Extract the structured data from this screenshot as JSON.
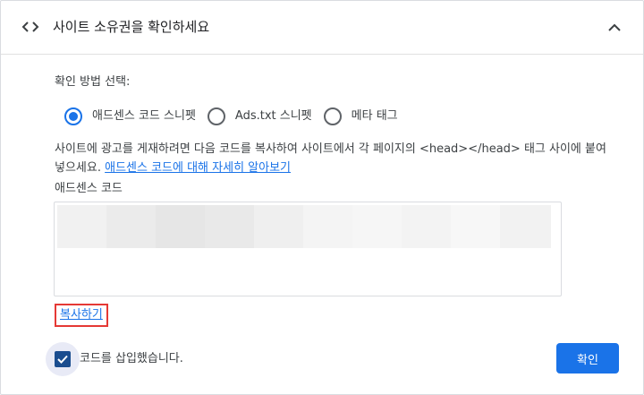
{
  "header": {
    "title": "사이트 소유권을 확인하세요",
    "left_icon": "code-icon",
    "right_icon": "chevron-up-icon"
  },
  "method": {
    "label": "확인 방법 선택:",
    "options": [
      {
        "label": "애드센스 코드 스니펫",
        "checked": true
      },
      {
        "label": "Ads.txt 스니펫",
        "checked": false
      },
      {
        "label": "메타 태그",
        "checked": false
      }
    ]
  },
  "description": {
    "text": "사이트에 광고를 게재하려면 다음 코드를 복사하여 사이트에서 각 페이지의 <head></head> 태그 사이에 붙여넣으세요. ",
    "link_text": "애드센스 코드에 대해 자세히 알아보기"
  },
  "code": {
    "label": "애드센스 코드",
    "copy_label": "복사하기"
  },
  "confirm": {
    "checkbox_label": "코드를 삽입했습니다.",
    "checked": true,
    "button_label": "확인"
  },
  "colors": {
    "accent": "#1a73e8",
    "highlight_border": "#e53935",
    "checkbox": "#1a4d8f"
  }
}
